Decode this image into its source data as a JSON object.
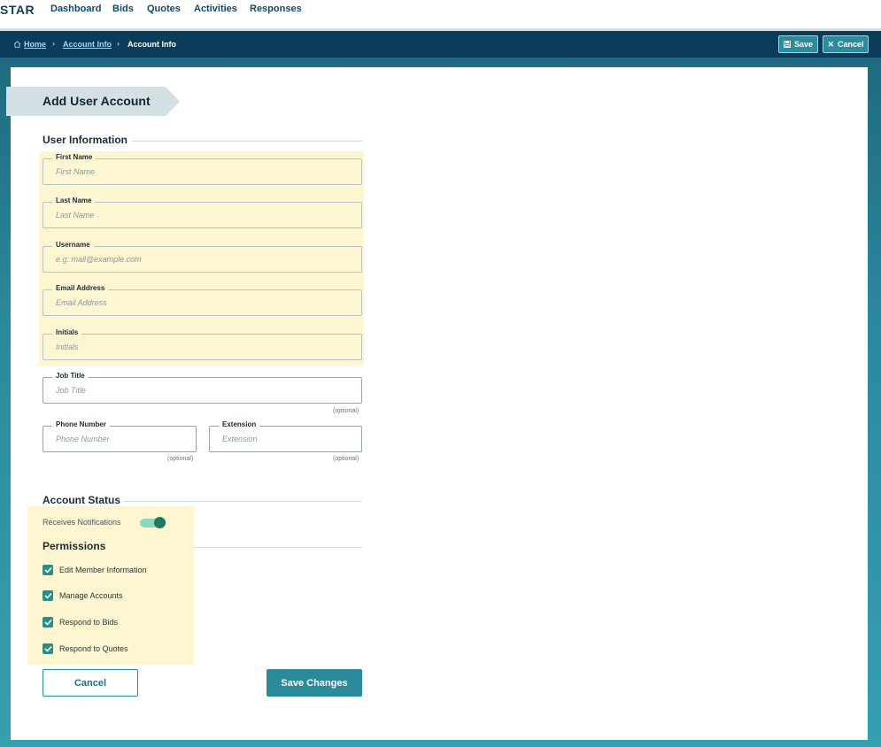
{
  "app": {
    "brand": "STAR"
  },
  "nav": {
    "items": [
      {
        "label": "Dashboard"
      },
      {
        "label": "Bids"
      },
      {
        "label": "Quotes"
      },
      {
        "label": "Activities"
      },
      {
        "label": "Responses"
      }
    ]
  },
  "breadcrumb": {
    "home": "Home",
    "account_info_link": "Account Info",
    "current": "Account Info"
  },
  "header_actions": {
    "save": "Save",
    "cancel": "Cancel"
  },
  "page": {
    "title": "Add User Account"
  },
  "user_information": {
    "heading": "User Information",
    "first_name": {
      "label": "First Name",
      "placeholder": "First Name"
    },
    "last_name": {
      "label": "Last Name",
      "placeholder": "Last Name"
    },
    "username": {
      "label": "Username",
      "placeholder": "e.g: mail@example.com"
    },
    "email": {
      "label": "Email Address",
      "placeholder": "Email Address"
    },
    "initials": {
      "label": "Initials",
      "placeholder": "Initials"
    },
    "job_title": {
      "label": "Job Title",
      "placeholder": "Job Title",
      "note": "(optional)"
    },
    "phone": {
      "label": "Phone Number",
      "placeholder": "Phone Number",
      "note": "(optional)"
    },
    "extension": {
      "label": "Extension",
      "placeholder": "Extension",
      "note": "(optional)"
    }
  },
  "account_status": {
    "heading": "Account Status",
    "notifications_label": "Receives Notifications",
    "notifications_on": true
  },
  "permissions": {
    "heading": "Permissions",
    "items": [
      {
        "label": "Edit Member Information",
        "checked": true
      },
      {
        "label": "Manage Accounts",
        "checked": true
      },
      {
        "label": "Respond to Bids",
        "checked": true
      },
      {
        "label": "Respond to Quotes",
        "checked": true
      }
    ]
  },
  "actions": {
    "cancel": "Cancel",
    "save_changes": "Save Changes"
  },
  "colors": {
    "brand_navy": "#0b3c5a",
    "accent_teal": "#2b8b9b",
    "highlight": "#fdf6d0",
    "toggle_on": "#1f7a5e"
  }
}
